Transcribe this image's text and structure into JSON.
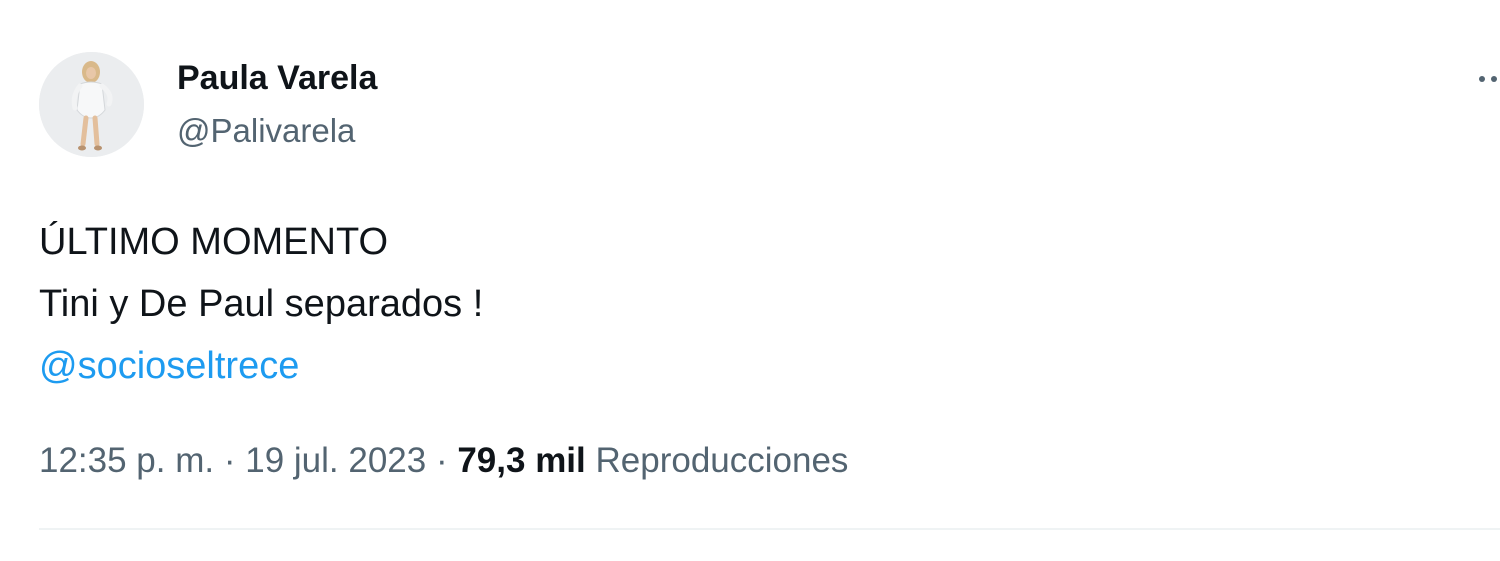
{
  "author": {
    "display_name": "Paula Varela",
    "handle": "@Palivarela",
    "avatar_icon": "profile-photo"
  },
  "tweet": {
    "lines": [
      "ÚLTIMO MOMENTO",
      "Tini y De Paul separados !"
    ],
    "mention": "@socioseltrece"
  },
  "meta": {
    "time": "12:35 p. m.",
    "separator": "·",
    "date": "19 jul. 2023",
    "views_count": "79,3 mil",
    "views_label": "Reproducciones"
  },
  "icons": {
    "more": "more-options-icon"
  },
  "colors": {
    "text_primary": "#0f1419",
    "text_secondary": "#536471",
    "link": "#1d9bf0",
    "divider": "#eff3f4"
  }
}
